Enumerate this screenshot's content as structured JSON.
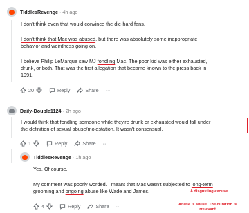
{
  "comments": [
    {
      "user": "TiddlesRevenge",
      "time": "4h ago",
      "paragraphs": {
        "p1": "I don't think even that would convince the die-hard fans.",
        "p2_underlined": "I don't think that Mac was abused",
        "p2_line1_rest": ", but there was absolutely some inappropriate",
        "p2_line2": "behavior and weirdness going on.",
        "p3_line1_a": "I believe Philip LeMarque saw MJ ",
        "p3_line1_ul": "fondling",
        "p3_line1_b": " Mac. The poor kid was either exhausted,",
        "p3_line2": "drunk, or both. That was the first allegation that became known to the press back in",
        "p3_line3": "1991."
      },
      "votes": "20",
      "reply_label": "Reply",
      "share_label": "Share",
      "more_label": "···"
    },
    {
      "user": "Daily-Double1124",
      "time": "2h ago",
      "lines": [
        "I would think that fondling someone while they're drunk or exhausted would fall under",
        "the definition of sexual abuse/molestation. It wasn't consensual."
      ],
      "votes": "1",
      "reply_label": "Reply",
      "share_label": "Share",
      "more_label": "···"
    },
    {
      "user": "TiddlesRevenge",
      "time": "1h ago",
      "p1": "Yes. Of course.",
      "p2_line1_a": "My comment was poorly worded. I meant that Mac wasn't subjected to ",
      "p2_line1_ul": "long-term",
      "p2_line2_a": "grooming and ",
      "p2_line2_ul": "ongoing",
      "p2_line2_b": " abuse like Wade and James.",
      "votes": "4",
      "reply_label": "Reply",
      "share_label": "Share",
      "more_label": "···"
    }
  ],
  "annotations": {
    "disgusting": "A disgusting excuse.",
    "duration_line1": "Abuse is abuse. The duration is",
    "duration_line2": "irrelevant."
  },
  "colors": {
    "annotation_red": "#e0202a",
    "reddit_orange": "#ff4500"
  },
  "icons": [
    "avatar",
    "upvote-icon",
    "downvote-icon",
    "reply-icon",
    "share-icon",
    "more-icon"
  ]
}
